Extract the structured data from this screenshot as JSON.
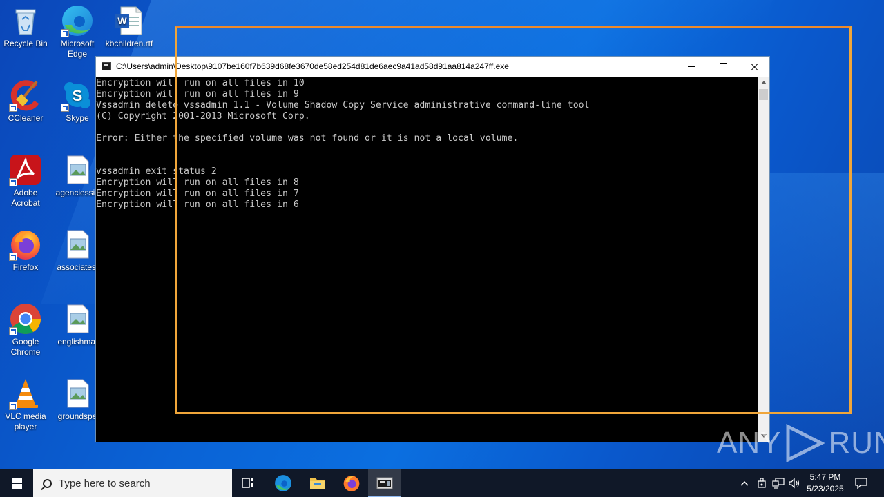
{
  "desktop": {
    "icons": [
      {
        "label": "Recycle Bin",
        "icon": "recycle-bin-icon"
      },
      {
        "label": "Microsoft Edge",
        "icon": "edge-icon"
      },
      {
        "label": "kbchildren.rtf",
        "icon": "word-document-icon"
      },
      {
        "label": "CCleaner",
        "icon": "ccleaner-icon"
      },
      {
        "label": "Skype",
        "icon": "skype-icon"
      },
      {
        "label": "Adobe Acrobat",
        "icon": "acrobat-icon"
      },
      {
        "label": "agenciessix",
        "icon": "image-file-icon"
      },
      {
        "label": "Firefox",
        "icon": "firefox-icon"
      },
      {
        "label": "associatesi",
        "icon": "image-file-icon"
      },
      {
        "label": "Google Chrome",
        "icon": "chrome-icon"
      },
      {
        "label": "englishmal",
        "icon": "image-file-icon"
      },
      {
        "label": "VLC media player",
        "icon": "vlc-icon"
      },
      {
        "label": "groundspe",
        "icon": "image-file-icon"
      }
    ]
  },
  "console": {
    "title": "C:\\Users\\admin\\Desktop\\9107be160f7b639d68fe3670de58ed254d81de6aec9a41ad58d91aa814a247ff.exe",
    "lines": [
      "Encryption will run on all files in 10",
      "Encryption will run on all files in 9",
      "Vssadmin delete vssadmin 1.1 - Volume Shadow Copy Service administrative command-line tool",
      "(C) Copyright 2001-2013 Microsoft Corp.",
      "",
      "Error: Either the specified volume was not found or it is not a local volume.",
      "",
      "",
      "vssadmin exit status 2",
      "Encryption will run on all files in 8",
      "Encryption will run on all files in 7",
      "Encryption will run on all files in 6"
    ]
  },
  "watermark": {
    "left": "ANY",
    "right": "RUN"
  },
  "taskbar": {
    "search_placeholder": "Type here to search",
    "pinned": [
      "task-view-icon",
      "edge-icon",
      "file-explorer-icon",
      "firefox-icon",
      "console-app-icon"
    ],
    "clock_time": "5:47 PM",
    "clock_date": "5/23/2025"
  },
  "colors": {
    "highlight_frame": "#f0a63a",
    "console_text": "#c8c8c8",
    "taskbar": "#101828"
  }
}
